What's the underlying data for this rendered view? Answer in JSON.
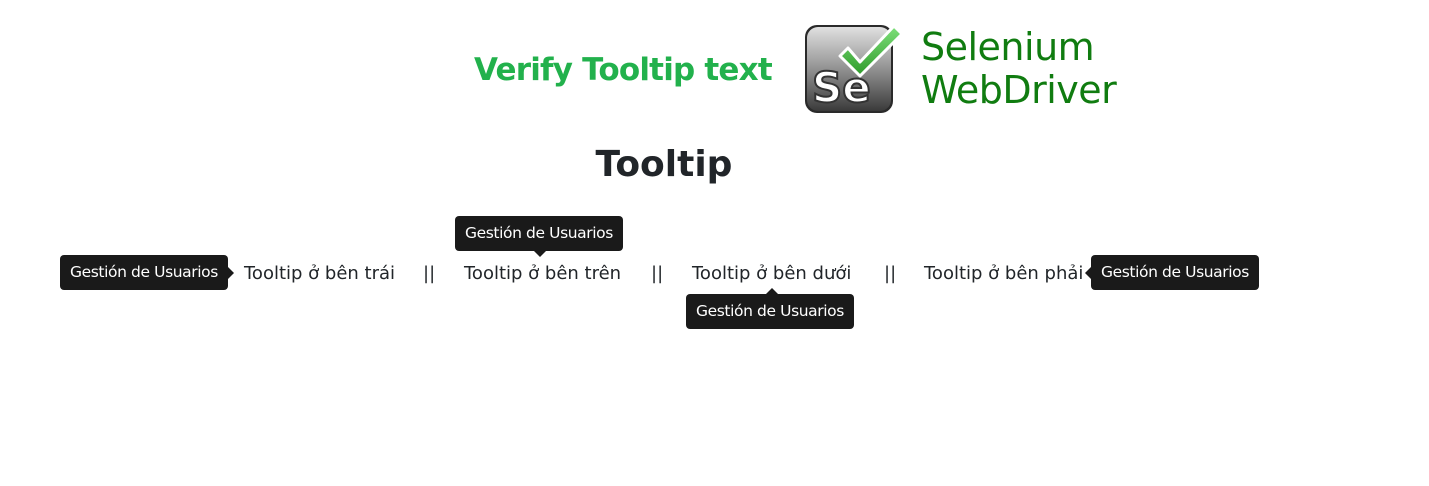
{
  "banner": {
    "title": "Verify Tooltip text",
    "logo": {
      "glyph": "Se",
      "line1": "Selenium",
      "line2": "WebDriver",
      "icon": "selenium-checkmark-logo"
    }
  },
  "heading": "Tooltip",
  "links": {
    "left": "Tooltip ở bên trái",
    "top": "Tooltip ở bên trên",
    "bottom": "Tooltip ở bên dưới",
    "right": "Tooltip ở bên phải",
    "separator": "||"
  },
  "tooltips": {
    "left": "Gestión de Usuarios",
    "top": "Gestión de Usuarios",
    "bottom": "Gestión de Usuarios",
    "right": "Gestión de Usuarios"
  },
  "colors": {
    "banner_title": "#22b14c",
    "logo_text": "#107c10",
    "tooltip_bg": "#1a1a1a",
    "text": "#212529"
  }
}
